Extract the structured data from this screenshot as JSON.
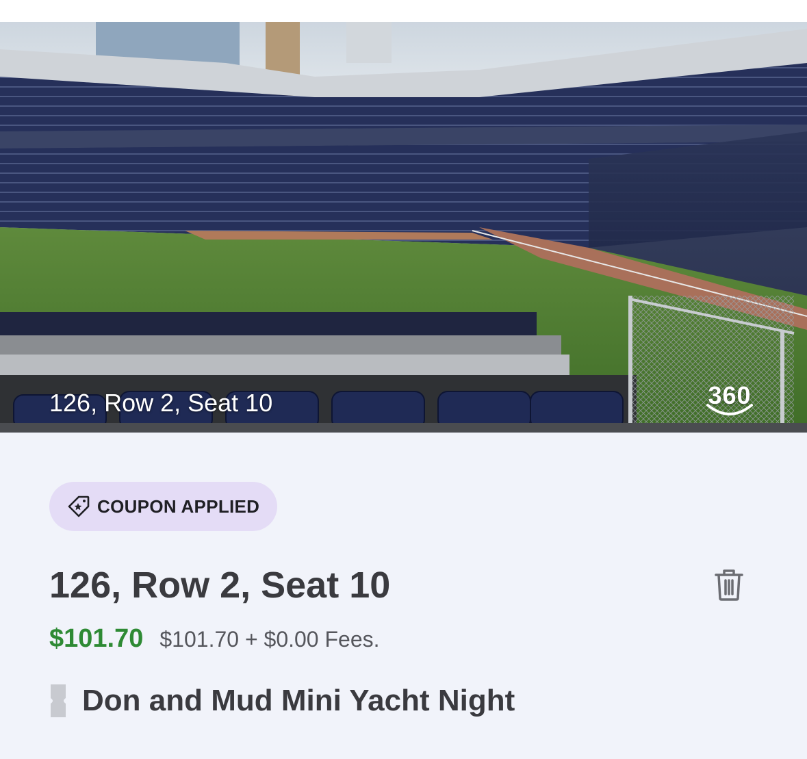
{
  "seat_view": {
    "caption": "126, Row 2, Seat 10",
    "view_360_label": "360"
  },
  "coupon": {
    "label": "COUPON APPLIED",
    "icon": "tag-star-icon"
  },
  "ticket": {
    "seat": "126, Row 2, Seat 10",
    "price": "$101.70",
    "breakdown": "$101.70 + $0.00 Fees.",
    "event": "Don and Mud Mini Yacht Night",
    "delete_icon": "trash-icon",
    "ticket_icon": "ticket-icon"
  },
  "colors": {
    "price_green": "#2e8a34",
    "coupon_bg": "#e4dcf6",
    "panel_bg": "#f1f3fa",
    "text_dark": "#3a3a3f"
  }
}
